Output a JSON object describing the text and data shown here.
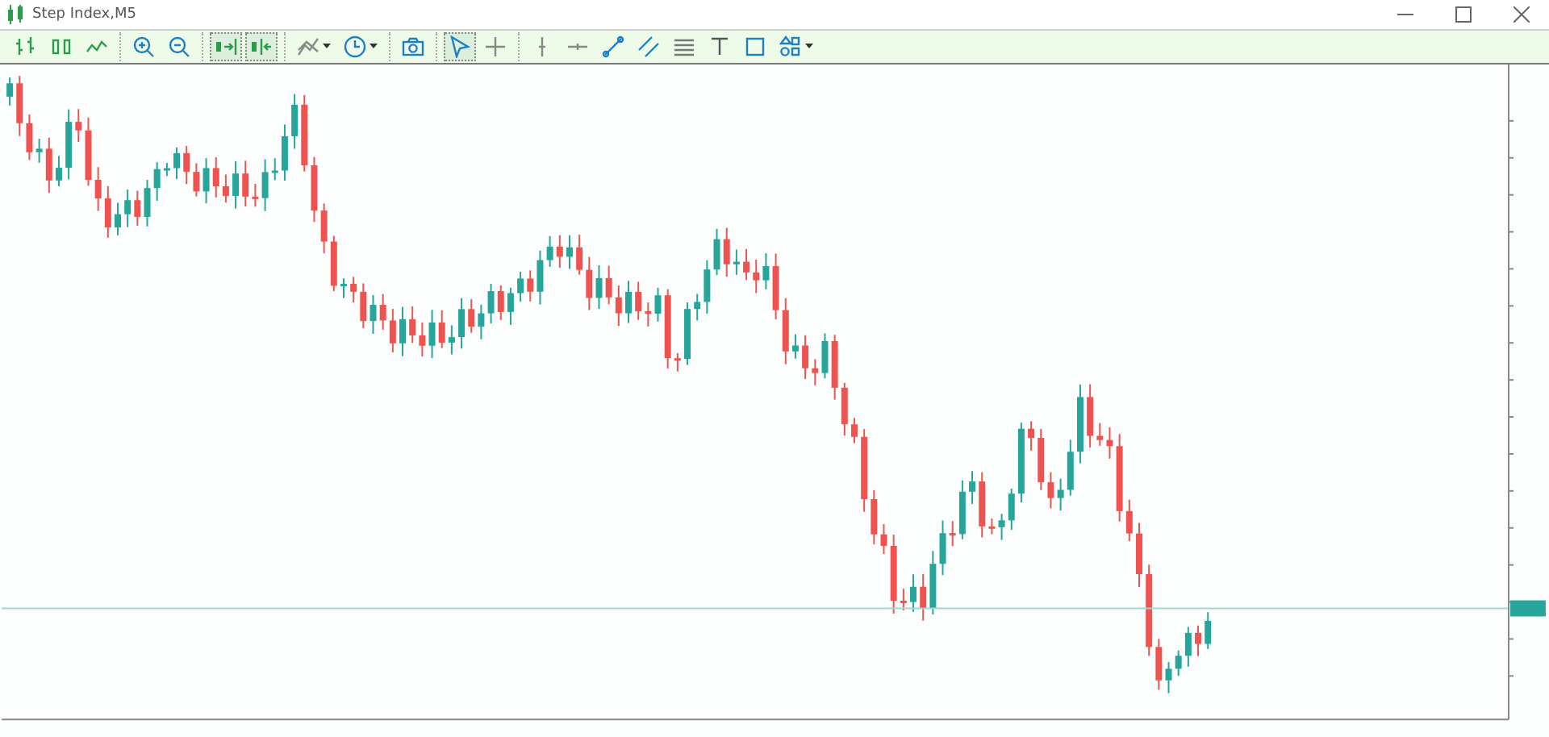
{
  "window": {
    "title": "Step Index,M5"
  },
  "toolbar": [
    {
      "items": [
        {
          "kind": "bar-chart",
          "selected": false,
          "dropdown": false
        },
        {
          "kind": "candles",
          "selected": false,
          "dropdown": false
        },
        {
          "kind": "line-chart",
          "selected": false,
          "dropdown": false
        }
      ]
    },
    {
      "items": [
        {
          "kind": "zoom-in",
          "selected": false,
          "dropdown": false
        },
        {
          "kind": "zoom-out",
          "selected": false,
          "dropdown": false
        }
      ]
    },
    {
      "items": [
        {
          "kind": "auto-scroll",
          "selected": true,
          "dropdown": false
        },
        {
          "kind": "chart-shift",
          "selected": true,
          "dropdown": false
        }
      ]
    },
    {
      "items": [
        {
          "kind": "indicators",
          "selected": false,
          "dropdown": true
        },
        {
          "kind": "periods",
          "selected": false,
          "dropdown": true
        }
      ]
    },
    {
      "items": [
        {
          "kind": "screenshot",
          "selected": false,
          "dropdown": false
        }
      ]
    },
    {
      "items": [
        {
          "kind": "cursor",
          "selected": true,
          "dropdown": false
        },
        {
          "kind": "crosshair",
          "selected": false,
          "dropdown": false
        }
      ]
    },
    {
      "items": [
        {
          "kind": "vertical-line",
          "selected": false,
          "dropdown": false
        },
        {
          "kind": "horizontal-line",
          "selected": false,
          "dropdown": false
        },
        {
          "kind": "trend-line",
          "selected": false,
          "dropdown": false
        },
        {
          "kind": "channel",
          "selected": false,
          "dropdown": false
        },
        {
          "kind": "fibonacci",
          "selected": false,
          "dropdown": false
        },
        {
          "kind": "text",
          "selected": false,
          "dropdown": false
        },
        {
          "kind": "rectangle",
          "selected": false,
          "dropdown": false
        },
        {
          "kind": "shapes",
          "selected": false,
          "dropdown": true
        }
      ]
    }
  ]
}
